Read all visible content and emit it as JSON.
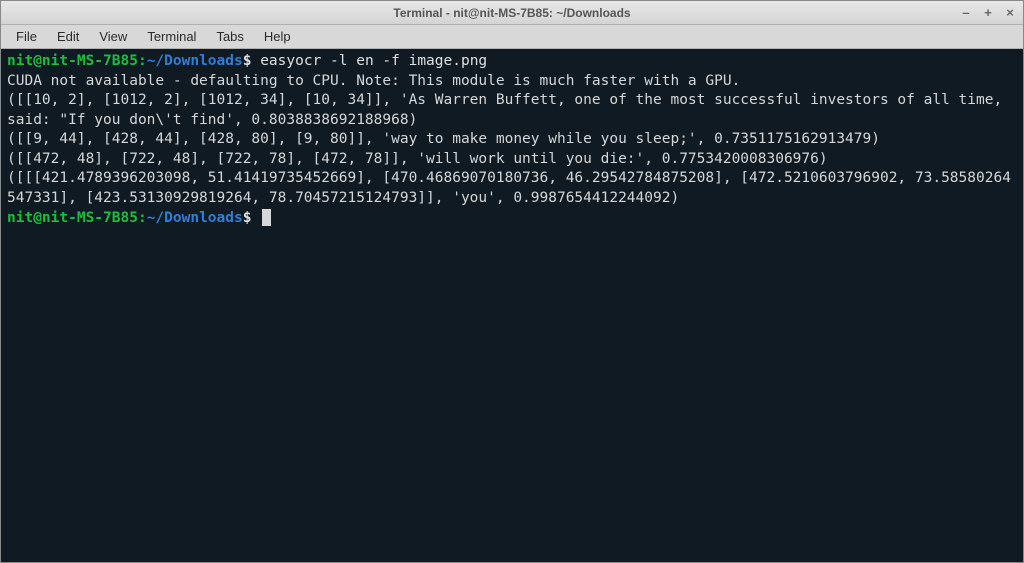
{
  "titlebar": {
    "title": "Terminal - nit@nit-MS-7B85: ~/Downloads",
    "minimize": "–",
    "maximize": "+",
    "close": "×"
  },
  "menubar": {
    "items": [
      "File",
      "Edit",
      "View",
      "Terminal",
      "Tabs",
      "Help"
    ]
  },
  "prompt": {
    "user_host": "nit@nit-MS-7B85",
    "sep": ":",
    "path": "~/Downloads",
    "dollar": "$"
  },
  "command": "easyocr -l en -f image.png",
  "output_lines": [
    "CUDA not available - defaulting to CPU. Note: This module is much faster with a GPU.",
    "([[10, 2], [1012, 2], [1012, 34], [10, 34]], 'As Warren Buffett, one of the most successful investors of all time, said: \"If you don\\'t find', 0.8038838692188968)",
    "([[9, 44], [428, 44], [428, 80], [9, 80]], 'way to make money while you sleep;', 0.7351175162913479)",
    "([[472, 48], [722, 48], [722, 78], [472, 78]], 'will work until you die:', 0.7753420008306976)",
    "([[[421.4789396203098, 51.41419735452669], [470.46869070180736, 46.29542784875208], [472.5210603796902, 73.58580264547331], [423.53130929819264, 78.70457215124793]], 'you', 0.9987654412244092)"
  ]
}
